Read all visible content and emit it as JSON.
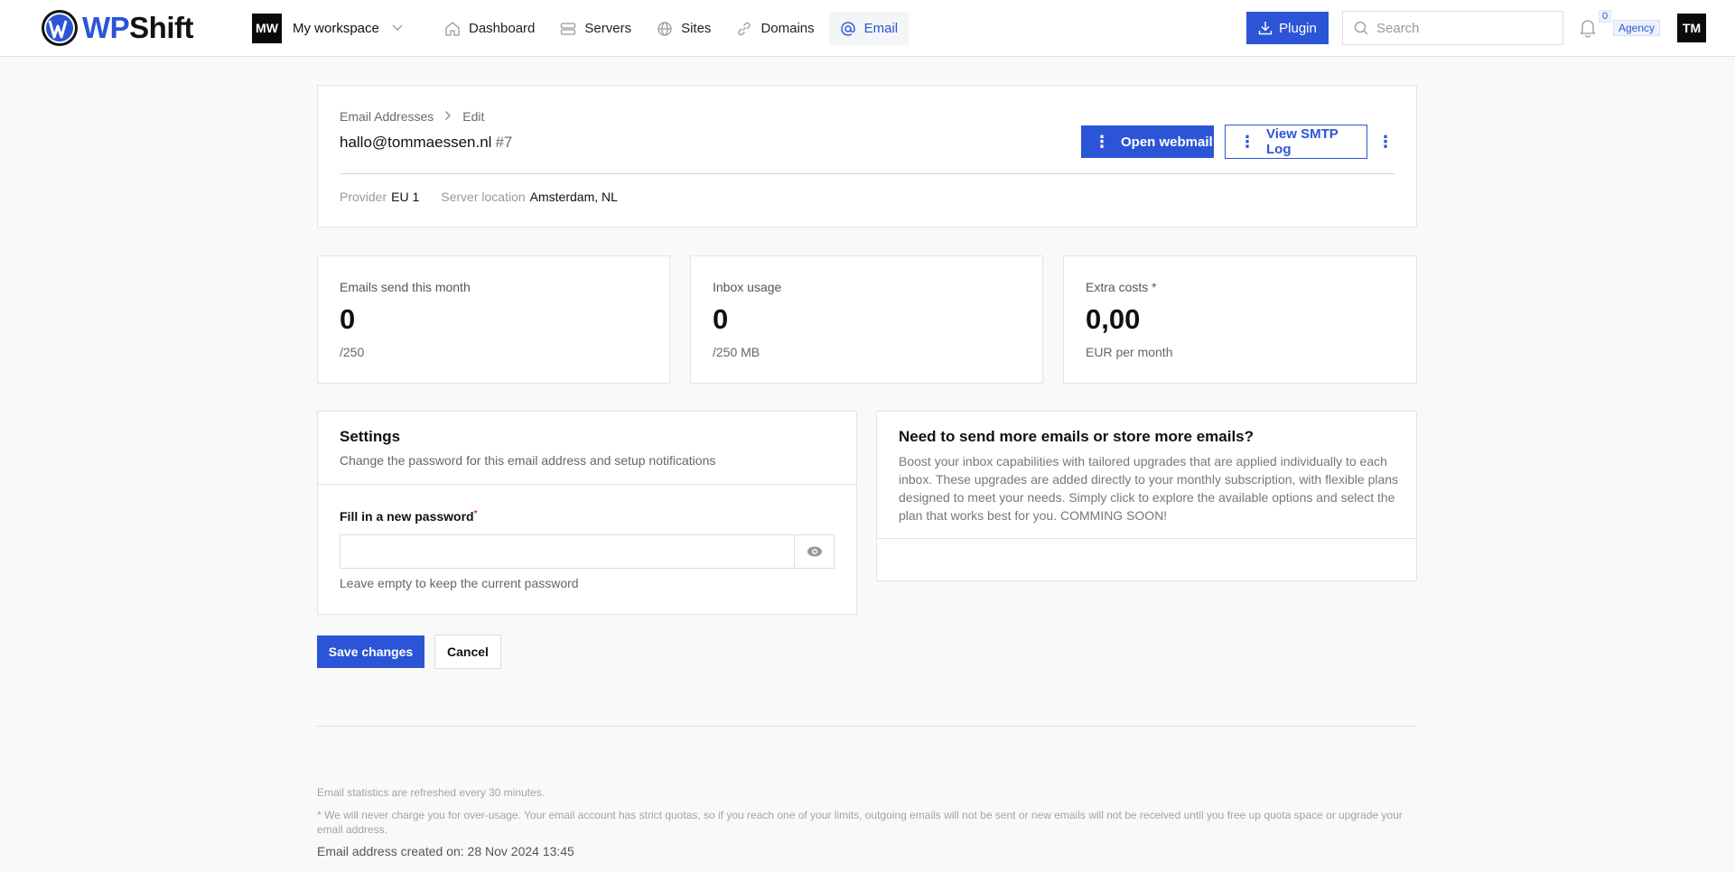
{
  "brand": {
    "name_part1": "WP",
    "name_part2": "Shift",
    "accent": "#2b55d6"
  },
  "workspace": {
    "badge": "MW",
    "name": "My workspace"
  },
  "nav": [
    {
      "label": "Dashboard",
      "icon": "home-icon",
      "active": false
    },
    {
      "label": "Servers",
      "icon": "server-icon",
      "active": false
    },
    {
      "label": "Sites",
      "icon": "globe-icon",
      "active": false
    },
    {
      "label": "Domains",
      "icon": "link-icon",
      "active": false
    },
    {
      "label": "Email",
      "icon": "at-icon",
      "active": true
    }
  ],
  "topbar": {
    "plugin_label": "Plugin",
    "search_placeholder": "Search",
    "notification_count": "0",
    "plan_badge": "Agency",
    "avatar_initials": "TM"
  },
  "header": {
    "breadcrumb": [
      "Email Addresses",
      "Edit"
    ],
    "email": "hallo@tommaessen.nl",
    "id": "#7",
    "open_webmail_label": "Open webmail",
    "view_smtp_label": "View SMTP Log",
    "meta": [
      {
        "label": "Provider",
        "value": "EU 1"
      },
      {
        "label": "Server location",
        "value": "Amsterdam, NL"
      }
    ]
  },
  "stats": [
    {
      "label": "Emails send this month",
      "value": "0",
      "sub": "/250"
    },
    {
      "label": "Inbox usage",
      "value": "0",
      "sub": "/250 MB"
    },
    {
      "label": "Extra costs *",
      "value": "0,00",
      "sub": "EUR per month"
    }
  ],
  "settings": {
    "title": "Settings",
    "description": "Change the password for this email address and setup notifications",
    "password_label": "Fill in a new password",
    "required_mark": "*",
    "password_value": "",
    "password_hint": "Leave empty to keep the current password"
  },
  "upgrade": {
    "title": "Need to send more emails or store more emails?",
    "body": "Boost your inbox capabilities with tailored upgrades that are applied individually to each inbox. These upgrades are added directly to your monthly subscription, with flexible plans designed to meet your needs. Simply click to explore the available options and select the plan that works best for you. COMMING SOON!"
  },
  "actions": {
    "save_label": "Save changes",
    "cancel_label": "Cancel"
  },
  "footer": {
    "refresh_note": "Email statistics are refreshed every 30 minutes.",
    "usage_note": "* We will never charge you for over-usage. Your email account has strict quotas, so if you reach one of your limits, outgoing emails will not be sent or new emails will not be received until you free up quota space or upgrade your email address.",
    "created": "Email address created on: 28 Nov 2024 13:45"
  }
}
